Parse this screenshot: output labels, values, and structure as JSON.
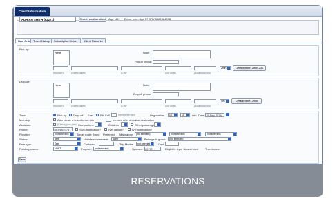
{
  "app": {
    "tab_title": "Client Information"
  },
  "client": {
    "name": "ADRIAN SMITH (62271)",
    "search_label": "Search another client",
    "age_label": "Age:",
    "age": "46",
    "driver_note": "Driver note: Age 57 DRV 5862584578"
  },
  "tabs": [
    "New Order",
    "Travel History",
    "Subscription History",
    "Client Remarks"
  ],
  "pickup": {
    "heading": "Pick-up:",
    "memo_value": "Home",
    "note_label": "Note:",
    "phone_label": "Pickup phone:",
    "col_number": "(Number)",
    "col_street": "(Street name)",
    "col_city": "(City)",
    "col_zip": "(Zip code)",
    "col_additional": "(Additional info)",
    "time_select": "2min Sel",
    "default_time": "Default time: 2min 23s"
  },
  "dropoff": {
    "heading": "Drop-off:",
    "memo_value": "Home",
    "note_label": "Note:",
    "phone_label": "Dropoff phone:",
    "col_number": "(Number)",
    "col_street": "(Street name)",
    "col_city": "(City)",
    "col_zip": "(Zip code)",
    "col_additional": "(Additional info)",
    "time_select": "Sec",
    "default_time": "Default time: 2min"
  },
  "details": {
    "time_label": "Time:",
    "pickup_opt": "Pick-up",
    "dropoff_opt": "Drop-off",
    "fast_opt": "Fast",
    "pcall_opt": "PH-Call",
    "pcall_hint": "(hh:mm/hh:mm)",
    "negotiation_label": "Negotiation:",
    "neg_from": "15",
    "neg_to": "15",
    "neg_unit": "min",
    "date_label": "Date:",
    "date_value": "15 Sep 2014",
    "main_trip_label": "Main trip:",
    "main_trip_text": "Also create a linked return trip",
    "minutes_text": "minutes after arrival at destination",
    "assistant_label": "Assistant:",
    "assistant_hint": "(Charity plus plan)",
    "companions_label": "Companions",
    "children_label": "Children",
    "other_pass_label": "Other passengers",
    "phone_label": "Phone:",
    "phone_value": "4802863775",
    "sms_label": "SMS notification?",
    "ivr_callout_label": "IVR callout?",
    "ivr_notif_label": "IVR notification?",
    "provider_label": "Provider:",
    "provider_value": "(not selected)",
    "target_route_label": "Target route:",
    "target_route_value": "None",
    "preferred_label": "Preferred:",
    "mandatory_label": "Mandatory:",
    "mandatory_value": "(not selected)",
    "not_sel_1": "(not selected)",
    "not_sel_2": "(not selected)",
    "status_label": "Status:",
    "status_value": "New",
    "vehicle_label": "Vehicle requirement:",
    "vehicle_value": "None",
    "belongs_label": "Belongs to group:",
    "belongs_value": "(not selected)",
    "fare_label": "Fare type:",
    "fare_value": "Taxi",
    "cost_label": "Cost/sec:",
    "trip_modes_label": "Trip Modes:",
    "trip_modes_value": "not selected",
    "cost2_label": "Cost:",
    "funding_label": "Funding source:",
    "funding_value": "MNET",
    "purpose_label": "Purpose:",
    "purpose_value": "(not selected)",
    "sponsor_label": "Sponsor:",
    "sponsor_value": "CIVIC",
    "eligibility_label": "Eligibility type: Unrestricted",
    "travel_zone": "Travel zone:",
    "save_label": "Save"
  },
  "caption": "RESERVATIONS",
  "colors": {
    "navy": "#0f2d6b",
    "accent": "#2a63c8",
    "card": "#868c95"
  }
}
